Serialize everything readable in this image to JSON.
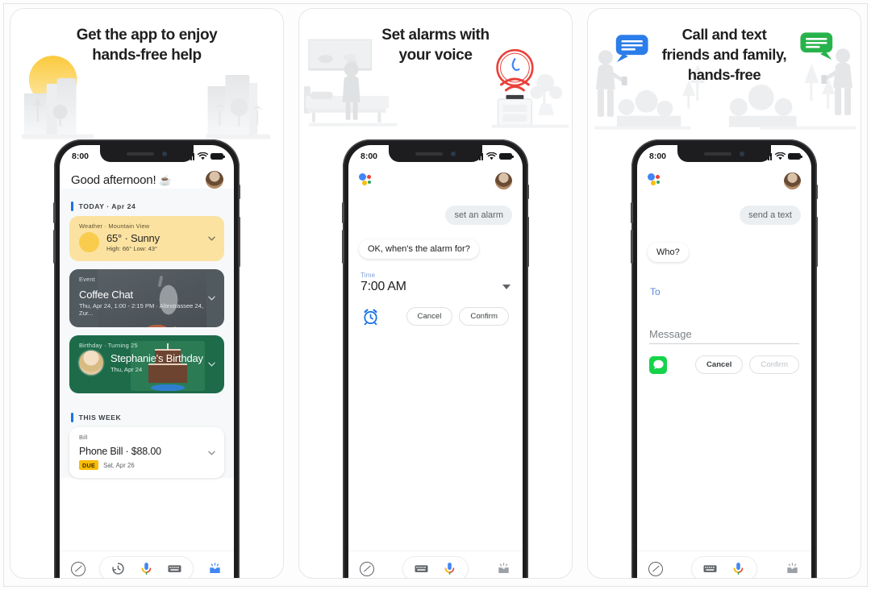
{
  "panels": [
    {
      "id": "panel-1",
      "headline": "Get the app to enjoy\nhands-free help",
      "headline_line1": "Get the app to enjoy",
      "headline_line2": "hands-free help",
      "illustration": "sunrise-cityscape-palm-trees",
      "phone": {
        "status": {
          "time": "8:00",
          "signal_icon": "cellular-bars-icon",
          "wifi_icon": "wifi-icon",
          "battery_icon": "battery-full-icon"
        },
        "greeting": "Good afternoon!",
        "greeting_emoji": "☕",
        "avatar": "user-avatar",
        "sections": [
          {
            "label": "TODAY · Apr 24",
            "cards": [
              {
                "type": "weather",
                "kicker": "Weather · Mountain View",
                "title": "65° · Sunny",
                "subtitle": "High: 66° Low: 43°",
                "icon": "sun-icon",
                "bg": "#fbe2a0",
                "chevron": "chevron-down-icon"
              },
              {
                "type": "event",
                "kicker": "Event",
                "title": "Coffee Chat",
                "subtitle": "Thu, Apr 24, 1:00 - 2:15 PM · Altestrassee 24, Zur...",
                "bg": "#515a5f",
                "chevron": "chevron-down-icon"
              },
              {
                "type": "birthday",
                "kicker": "Birthday · Turning 25",
                "title": "Stephanie's Birthday",
                "subtitle": "Thu, Apr 24",
                "bg": "#1e6b4a",
                "chevron": "chevron-down-icon"
              }
            ]
          },
          {
            "label": "THIS WEEK",
            "cards": [
              {
                "type": "bill",
                "kicker": "Bill",
                "title": "Phone Bill · $88.00",
                "badge": "DUE",
                "badge_color": "#fbbc04",
                "due_date": "Sat, Apr 26",
                "bg": "#ffffff",
                "chevron": "chevron-down-icon"
              }
            ]
          }
        ],
        "navbar": {
          "explore": "explore-icon",
          "history": "history-icon",
          "mic": "google-mic-icon",
          "keyboard": "keyboard-icon",
          "inbox": "inbox-icon",
          "inbox_color": "#4285f4"
        }
      }
    },
    {
      "id": "panel-2",
      "headline_line1": "Set alarms with",
      "headline_line2": "your voice",
      "illustration": "bedroom-alarm-clock",
      "phone": {
        "status": {
          "time": "8:00",
          "signal_icon": "cellular-bars-icon",
          "wifi_icon": "wifi-icon",
          "battery_icon": "battery-full-icon"
        },
        "assistant_logo": "google-assistant-icon",
        "avatar": "user-avatar",
        "user_message": "set an alarm",
        "bot_message": "OK, when's the alarm for?",
        "form": {
          "field_label": "Time",
          "field_value": "7:00 AM",
          "dropdown_icon": "caret-down-icon",
          "leading_icon": "alarm-clock-icon",
          "cancel_label": "Cancel",
          "confirm_label": "Confirm"
        },
        "navbar": {
          "explore": "explore-icon",
          "keyboard": "keyboard-icon",
          "mic": "google-mic-icon",
          "inbox": "inbox-icon",
          "inbox_color": "#9aa0a6"
        }
      }
    },
    {
      "id": "panel-3",
      "headline_line1": "Call and text",
      "headline_line2": "friends and family,",
      "headline_line3": "hands-free",
      "illustration": "two-people-texting-chat-bubbles",
      "phone": {
        "status": {
          "time": "8:00",
          "signal_icon": "cellular-bars-icon",
          "wifi_icon": "wifi-icon",
          "battery_icon": "battery-full-icon"
        },
        "assistant_logo": "google-assistant-icon",
        "avatar": "user-avatar",
        "user_message": "send a text",
        "bot_message": "Who?",
        "form": {
          "to_label": "To",
          "message_placeholder": "Message",
          "leading_icon": "messages-app-icon",
          "cancel_label": "Cancel",
          "confirm_label": "Confirm"
        },
        "navbar": {
          "explore": "explore-icon",
          "keyboard": "keyboard-icon",
          "mic": "google-mic-icon",
          "inbox": "inbox-icon",
          "inbox_color": "#9aa0a6"
        }
      }
    }
  ],
  "colors": {
    "accent_blue": "#1a73e8",
    "weather_yellow": "#fbe2a0",
    "event_gray": "#515a5f",
    "birthday_green": "#1e6b4a",
    "due_yellow": "#fbbc04",
    "messages_green": "#16d34a",
    "page_bg": "#ffffff"
  }
}
